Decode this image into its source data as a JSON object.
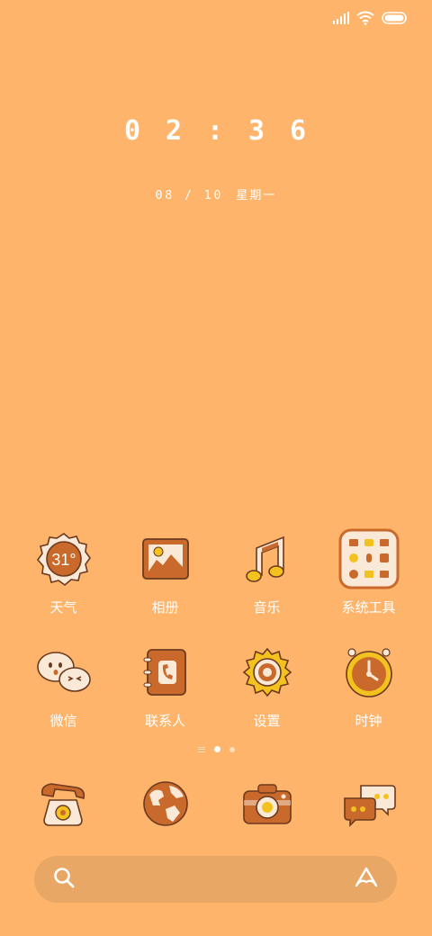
{
  "status_bar": {
    "signal": "signal-icon",
    "wifi": "wifi-icon",
    "battery": "battery-icon"
  },
  "clock": {
    "h1": "0",
    "h2": "2",
    "sep": ":",
    "m1": "3",
    "m2": "6"
  },
  "date": {
    "day": "08 / 10",
    "weekday": "星期一"
  },
  "apps": {
    "row1": [
      {
        "label": "天气",
        "icon": "weather-icon",
        "temp": "31°"
      },
      {
        "label": "相册",
        "icon": "gallery-icon"
      },
      {
        "label": "音乐",
        "icon": "music-icon"
      },
      {
        "label": "系统工具",
        "icon": "system-tools-folder-icon"
      }
    ],
    "row2": [
      {
        "label": "微信",
        "icon": "wechat-icon"
      },
      {
        "label": "联系人",
        "icon": "contacts-icon"
      },
      {
        "label": "设置",
        "icon": "settings-icon"
      },
      {
        "label": "时钟",
        "icon": "clock-icon"
      }
    ]
  },
  "dock": [
    {
      "icon": "phone-icon"
    },
    {
      "icon": "browser-globe-icon"
    },
    {
      "icon": "camera-icon"
    },
    {
      "icon": "messages-icon"
    }
  ],
  "search": {
    "left_icon": "search-icon",
    "right_icon": "assistant-icon"
  },
  "colors": {
    "background": "#FFB46B",
    "icon_brown": "#C96A2C",
    "icon_cream": "#FBE9D7",
    "icon_yellow": "#F4C21E",
    "outline": "#6B3A1F"
  }
}
